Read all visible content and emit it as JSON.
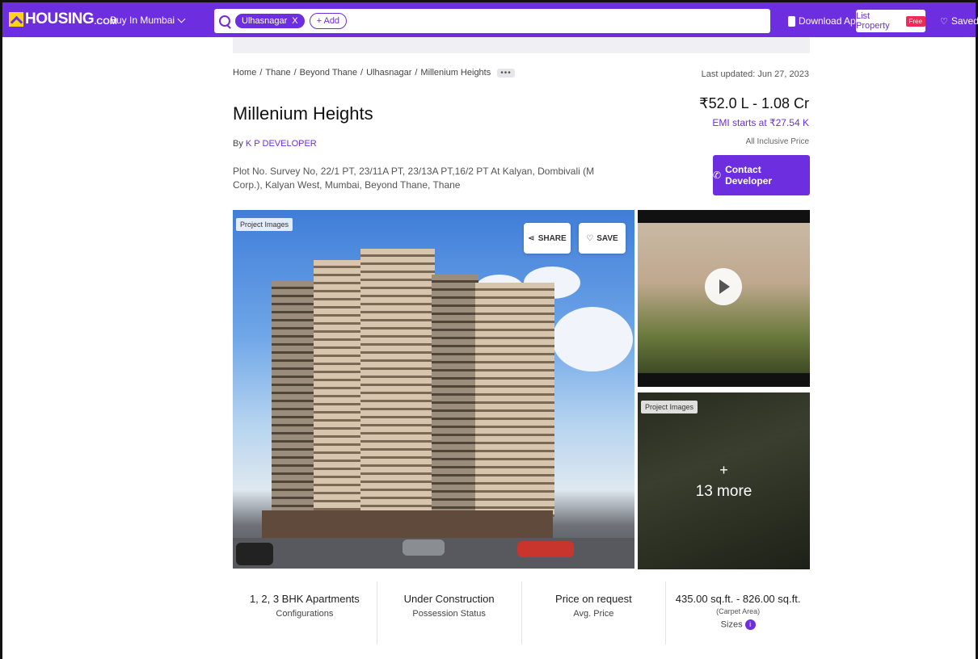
{
  "header": {
    "logo_text": "HOUSING",
    "logo_suffix": ".COM",
    "city_select": "Buy In Mumbai",
    "search_chip": "Ulhasnagar",
    "search_chip_close": "X",
    "add_label": "+ Add",
    "download_app": "Download App",
    "list_property": "List Property",
    "free_badge": "Free",
    "saved": "Saved"
  },
  "breadcrumb": {
    "items": [
      "Home",
      "Thane",
      "Beyond Thane",
      "Ulhasnagar",
      "Millenium Heights"
    ],
    "more": "•••"
  },
  "last_updated": "Last updated: Jun 27, 2023",
  "project": {
    "title": "Millenium Heights",
    "by_prefix": "By",
    "developer": "K P DEVELOPER",
    "address": "Plot No. Survey No, 22/1 PT, 23/11A PT, 23/13A PT,16/2 PT At Kalyan, Dombivali (M Corp.), Kalyan West, Mumbai, Beyond Thane, Thane",
    "price": "₹52.0 L - 1.08 Cr",
    "emi": "EMI starts at ₹27.54 K",
    "inclusive": "All Inclusive Price",
    "contact_button": "Contact Developer"
  },
  "gallery": {
    "main_label": "Project Images",
    "share": "SHARE",
    "save": "SAVE",
    "second_label": "Project Images",
    "more_plus": "+",
    "more_count": "13 more"
  },
  "stats": [
    {
      "value": "1, 2, 3 BHK Apartments",
      "label": "Configurations"
    },
    {
      "value": "Under Construction",
      "label": "Possession Status"
    },
    {
      "value": "Price on request",
      "label": "Avg. Price"
    },
    {
      "value": "435.00 sq.ft. - 826.00 sq.ft.",
      "sub": "(Carpet Area)",
      "label": "Sizes"
    }
  ],
  "colors": {
    "brand": "#6d2ee0",
    "badge": "#ee2a56"
  }
}
